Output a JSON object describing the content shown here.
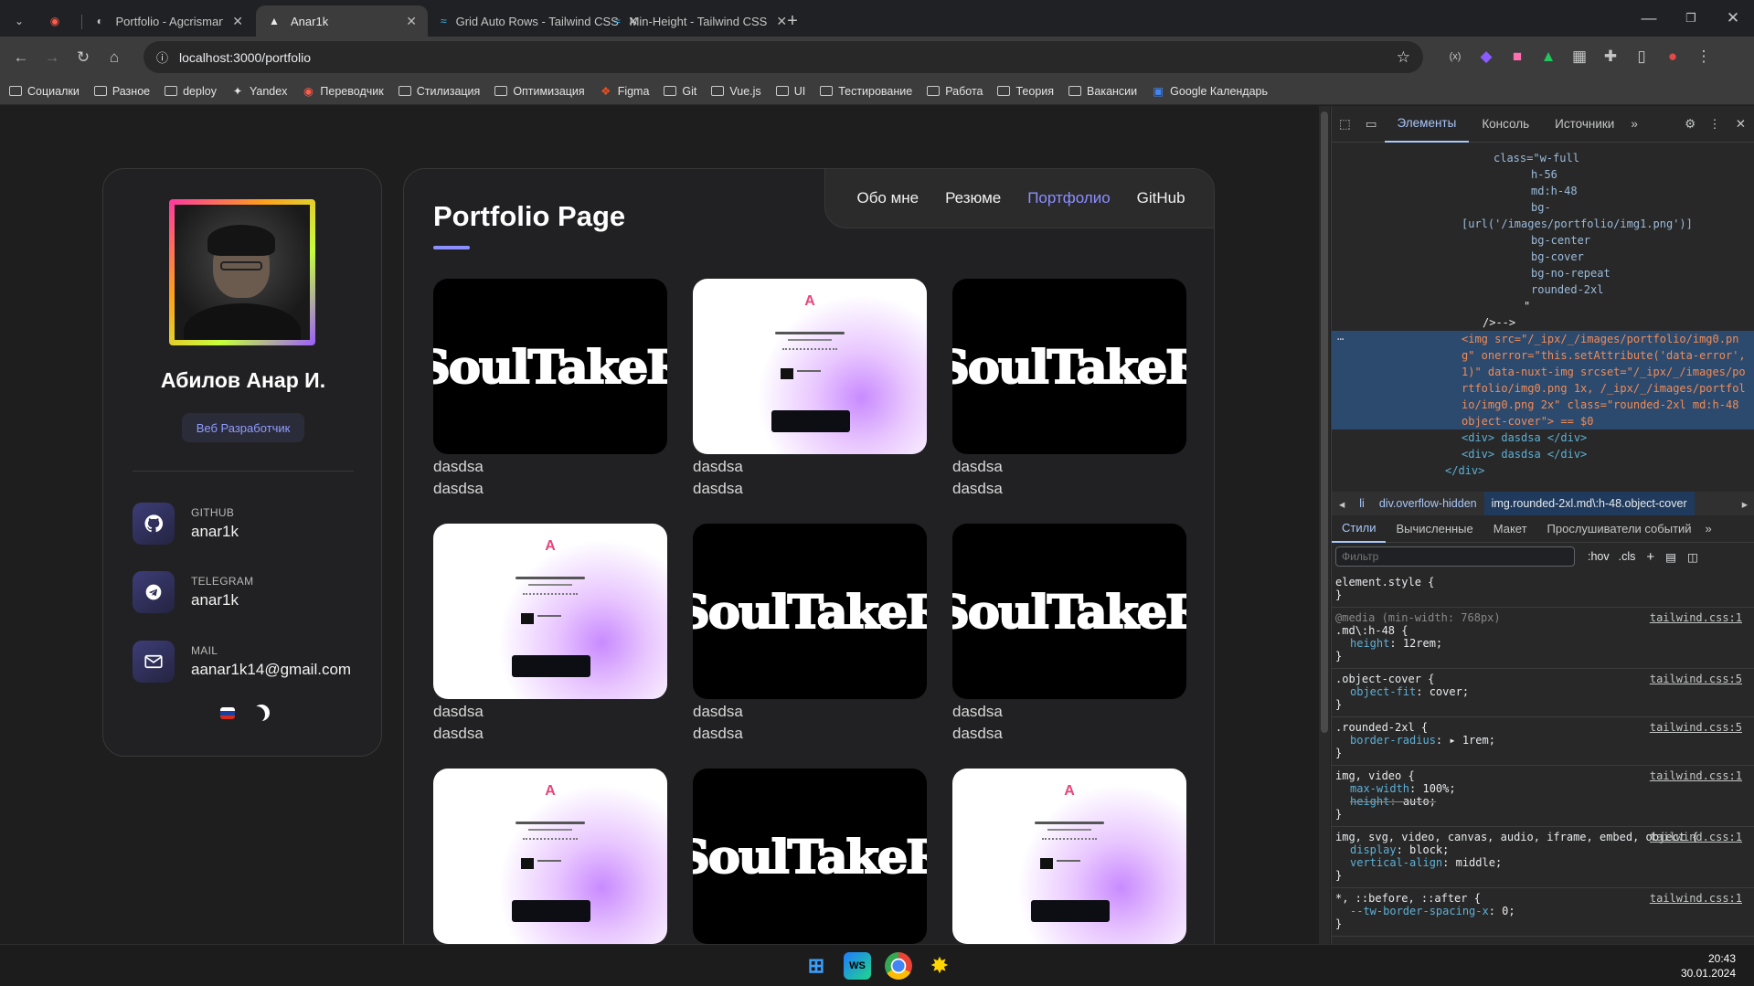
{
  "browser": {
    "tabs": [
      {
        "title": "Portfolio - Agcrismanto Budhi",
        "active": false
      },
      {
        "title": "Anar1k",
        "active": true
      },
      {
        "title": "Grid Auto Rows - Tailwind CSS",
        "active": false
      },
      {
        "title": "Min-Height - Tailwind CSS",
        "active": false
      }
    ],
    "url": "localhost:3000/portfolio",
    "bookmarks": [
      "Социалки",
      "Разное",
      "deploy",
      "Yandex",
      "Переводчик",
      "Стилизация",
      "Оптимизация",
      "Figma",
      "Git",
      "Vue.js",
      "UI",
      "Тестирование",
      "Работа",
      "Теория",
      "Вакансии",
      "Google Календарь"
    ]
  },
  "profile": {
    "name": "Абилов Анар И.",
    "role": "Веб Разработчик",
    "contacts": [
      {
        "label": "GITHUB",
        "value": "anar1k",
        "icon": "github-icon"
      },
      {
        "label": "TELEGRAM",
        "value": "anar1k",
        "icon": "telegram-icon"
      },
      {
        "label": "MAIL",
        "value": "aanar1k14@gmail.com",
        "icon": "mail-icon"
      }
    ]
  },
  "nav": {
    "items": [
      "Обо мне",
      "Резюме",
      "Портфолио",
      "GitHub"
    ],
    "active_index": 2
  },
  "portfolio": {
    "title": "Portfolio Page",
    "logo_text": "SoulTakeR",
    "items": [
      {
        "kind": "dark",
        "line1": "dasdsa",
        "line2": "dasdsa"
      },
      {
        "kind": "light",
        "line1": "dasdsa",
        "line2": "dasdsa"
      },
      {
        "kind": "dark",
        "line1": "dasdsa",
        "line2": "dasdsa"
      },
      {
        "kind": "light",
        "line1": "dasdsa",
        "line2": "dasdsa"
      },
      {
        "kind": "dark",
        "line1": "dasdsa",
        "line2": "dasdsa"
      },
      {
        "kind": "dark",
        "line1": "dasdsa",
        "line2": "dasdsa"
      },
      {
        "kind": "light",
        "line1": "",
        "line2": ""
      },
      {
        "kind": "dark",
        "line1": "",
        "line2": ""
      },
      {
        "kind": "light",
        "line1": "",
        "line2": ""
      }
    ]
  },
  "devtools": {
    "tabs": [
      "Элементы",
      "Консоль",
      "Источники"
    ],
    "dom_lines": [
      "class=\"w-full",
      "h-56",
      "md:h-48",
      "bg-",
      "[url('/images/portfolio/img1.png')]",
      "bg-center",
      "bg-cover",
      "bg-no-repeat",
      "rounded-2xl",
      "\"",
      "/>-->"
    ],
    "img_src": "/_ipx/_/images/portfolio/img0.png",
    "img_line": "<img src=\"/_ipx/_/images/portfolio/img0.png\" onerror=\"this.setAttribute('data-error', 1)\" data-nuxt-img srcset=\"/_ipx/_/images/portfolio/img0.png 1x, /_ipx/_/images/portfolio/img0.png 2x\" class=\"rounded-2xl md:h-48 object-cover\"> == $0",
    "div1": "<div> dasdsa </div>",
    "div2": "<div> dasdsa </div>",
    "div_close": "</div>",
    "breadcrumbs": [
      "li",
      "div.overflow-hidden",
      "img.rounded-2xl.md\\:h-48.object-cover"
    ],
    "style_tabs": [
      "Стили",
      "Вычисленные",
      "Макет",
      "Прослушиватели событий"
    ],
    "filter_placeholder": "Фильтр",
    "filter_buttons": [
      ":hov",
      ".cls"
    ],
    "rules": [
      {
        "pre": "",
        "selector": "element.style {",
        "src": "",
        "props": []
      },
      {
        "pre": "@media (min-width: 768px)",
        "selector": ".md\\:h-48 {",
        "src": "tailwind.css:1",
        "props": [
          [
            "height",
            "12rem;"
          ]
        ]
      },
      {
        "pre": "",
        "selector": ".object-cover {",
        "src": "tailwind.css:5",
        "props": [
          [
            "object-fit",
            "cover;"
          ]
        ]
      },
      {
        "pre": "",
        "selector": ".rounded-2xl {",
        "src": "tailwind.css:5",
        "props": [
          [
            "border-radius",
            "▸ 1rem;"
          ]
        ]
      },
      {
        "pre": "",
        "selector": "img, video {",
        "src": "tailwind.css:1",
        "props": [
          [
            "max-width",
            "100%;"
          ],
          [
            "height",
            "auto;"
          ]
        ]
      },
      {
        "pre": "",
        "selector": "img, svg, video, canvas, audio, iframe, embed, object {",
        "src": "tailwind.css:1",
        "props": [
          [
            "display",
            "block;"
          ],
          [
            "vertical-align",
            "middle;"
          ]
        ]
      },
      {
        "pre": "",
        "selector": "*, ::before, ::after {",
        "src": "tailwind.css:1",
        "props": [
          [
            "--tw-border-spacing-x",
            "0;"
          ]
        ]
      }
    ]
  },
  "taskbar": {
    "time": "20:43",
    "date": "30.01.2024"
  },
  "colors": {
    "accent": "#8c8fff",
    "card_bg": "#212123",
    "page_bg": "#1e1e1f"
  }
}
